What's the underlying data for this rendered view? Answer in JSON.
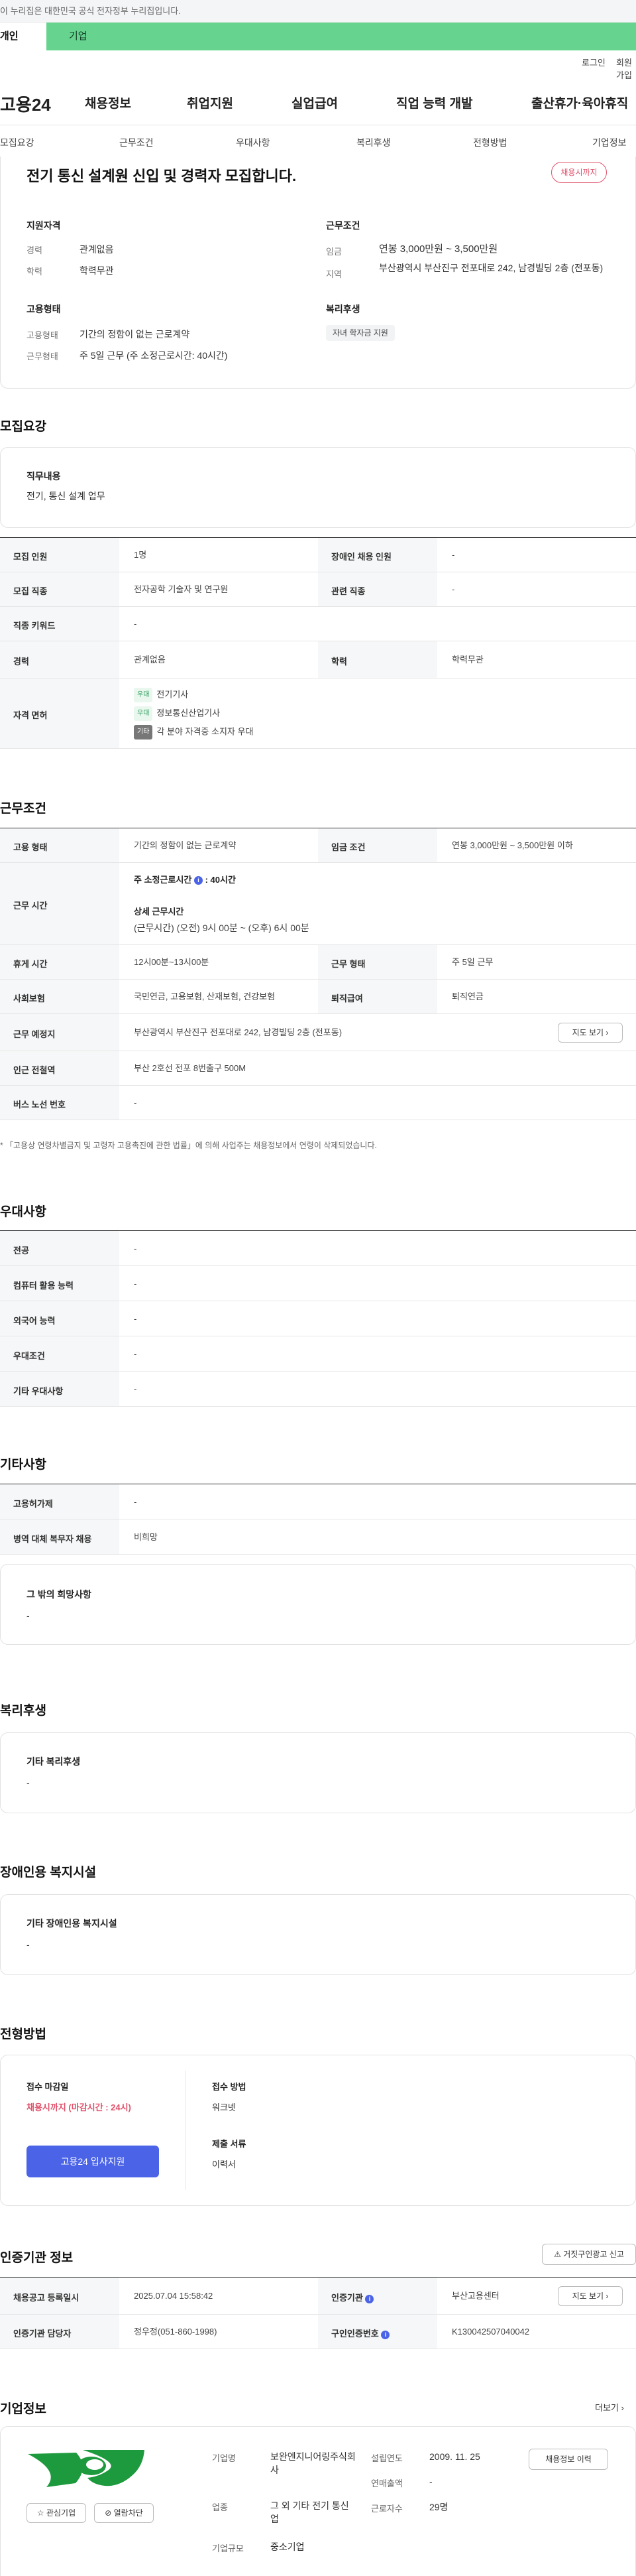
{
  "gov_banner": "이 누리집은 대한민국 공식 전자정부 누리집입니다.",
  "user_tabs": [
    "개인",
    "기업"
  ],
  "auth": [
    "로그인",
    "회원가입"
  ],
  "logo": "고용24",
  "gnb": [
    "채용정보",
    "취업지원",
    "실업급여",
    "직업 능력 개발",
    "출산휴가·육아휴직"
  ],
  "subnav": [
    "모집요강",
    "근무조건",
    "우대사항",
    "복리후생",
    "전형방법",
    "기업정보"
  ],
  "job": {
    "title": "전기 통신 설계원 신입 및 경력자 모집합니다.",
    "status": "채용시까지",
    "qualification": {
      "heading": "지원자격",
      "items": [
        {
          "label": "경력",
          "value": "관계없음"
        },
        {
          "label": "학력",
          "value": "학력무관"
        }
      ]
    },
    "conditions": {
      "heading": "근무조건",
      "items": [
        {
          "label": "임금",
          "value": "연봉 3,000만원 ~ 3,500만원"
        },
        {
          "label": "지역",
          "value": "부산광역시 부산진구 전포대로 242, 남경빌딩 2층 (전포동)"
        }
      ]
    },
    "employment": {
      "heading": "고용형태",
      "items": [
        {
          "label": "고용형태",
          "value": "기간의 정함이 없는 근로계약"
        },
        {
          "label": "근무형태",
          "value": "주 5일 근무 (주 소정근로시간: 40시간)"
        }
      ]
    },
    "welfare": {
      "heading": "복리후생",
      "pill": "자녀 학자금 지원"
    }
  },
  "recruit": {
    "heading": "모집요강",
    "duty_label": "직무내용",
    "duty_value": "전기, 통신 설계 업무",
    "rows": {
      "headcount": {
        "label": "모집 인원",
        "value": "1명"
      },
      "disabled": {
        "label": "장애인 채용 인원",
        "value": "-"
      },
      "occupation": {
        "label": "모집 직종",
        "value": "전자공학 기술자 및 연구원"
      },
      "related": {
        "label": "관련 직종",
        "value": "-"
      },
      "keyword": {
        "label": "직종 키워드",
        "value": "-"
      },
      "career": {
        "label": "경력",
        "value": "관계없음"
      },
      "education": {
        "label": "학력",
        "value": "학력무관"
      },
      "license": {
        "label": "자격 면허",
        "items": [
          {
            "tag": "우대",
            "text": "전기기사"
          },
          {
            "tag": "우대",
            "text": "정보통신산업기사"
          },
          {
            "tag": "기타",
            "text": "각 분야 자격증 소지자 우대"
          }
        ]
      }
    }
  },
  "work": {
    "heading": "근무조건",
    "emp_type": {
      "label": "고용 형태",
      "value": "기간의 정함이 없는 근로계약"
    },
    "wage": {
      "label": "임금 조건",
      "value": "연봉 3,000만원 ~ 3,500만원 이하"
    },
    "hours": {
      "label": "근무 시간",
      "weekly_title": "주 소정근로시간",
      "weekly_value": "40시간",
      "detail_title": "상세 근무시간",
      "detail_value": "(근무시간) (오전) 9시 00분 ~ (오후) 6시 00분"
    },
    "break": {
      "label": "휴게 시간",
      "value": "12시00분~13시00분"
    },
    "form": {
      "label": "근무 형태",
      "value": "주 5일 근무"
    },
    "insurance": {
      "label": "사회보험",
      "value": "국민연금, 고용보험, 산재보험, 건강보험"
    },
    "severance": {
      "label": "퇴직급여",
      "value": "퇴직연금"
    },
    "location": {
      "label": "근무 예정지",
      "value": "부산광역시 부산진구 전포대로 242, 남경빌딩 2층 (전포동)",
      "button": "지도 보기"
    },
    "subway": {
      "label": "인근 전철역",
      "value": "부산 2호선 전포 8번출구 500M"
    },
    "bus": {
      "label": "버스 노선 번호",
      "value": "-"
    },
    "note": "* 「고용상 연령차별금지 및 고령자 고용촉진에 관한 법률」에 의해 사업주는 채용정보에서 연령이 삭제되었습니다."
  },
  "preference": {
    "heading": "우대사항",
    "rows": [
      {
        "label": "전공",
        "value": "-"
      },
      {
        "label": "컴퓨터 활용 능력",
        "value": "-"
      },
      {
        "label": "외국어 능력",
        "value": "-"
      },
      {
        "label": "우대조건",
        "value": "-"
      },
      {
        "label": "기타 우대사항",
        "value": "-"
      }
    ]
  },
  "etc": {
    "heading": "기타사항",
    "rows": [
      {
        "label": "고용허가제",
        "value": "-"
      },
      {
        "label": "병역 대체 복무자 채용",
        "value": "비희망"
      }
    ],
    "hope_label": "그 밖의 희망사항",
    "hope_value": "-"
  },
  "benefits": {
    "heading": "복리후생",
    "label": "기타 복리후생",
    "value": "-"
  },
  "facility": {
    "heading": "장애인용 복지시설",
    "label": "기타 장애인용 복지시설",
    "value": "-"
  },
  "process": {
    "heading": "전형방법",
    "deadline_label": "접수 마감일",
    "deadline_value": "채용시까지 (마감시간 : 24시)",
    "apply_button": "고용24 입사지원",
    "method_label": "접수 방법",
    "method_value": "워크넷",
    "docs_label": "제출 서류",
    "docs_value": "이력서"
  },
  "cert": {
    "heading": "인증기관 정보",
    "report_button": "거짓구인광고 신고",
    "reg_date": {
      "label": "채용공고 등록일시",
      "value": "2025.07.04 15:58:42"
    },
    "agency": {
      "label": "인증기관",
      "value": "부산고용센터",
      "button": "지도 보기"
    },
    "manager": {
      "label": "인증기관 담당자",
      "value": "정우정(051-860-1998)"
    },
    "number": {
      "label": "구인인증번호",
      "value": "K130042507040042"
    }
  },
  "company": {
    "heading": "기업정보",
    "more": "더보기",
    "fav_button": "관심기업",
    "block_button": "열람차단",
    "name_label": "기업명",
    "name_value": "보완엔지니어링주식회사",
    "industry_label": "업종",
    "industry_value": "그 외 기타 전기 통신업",
    "size_label": "기업규모",
    "size_value": "중소기업",
    "founded_label": "설립연도",
    "founded_value": "2009. 11. 25",
    "revenue_label": "연매출액",
    "revenue_value": "-",
    "employees_label": "근로자수",
    "employees_value": "29명",
    "history_button": "채용정보 이력",
    "brand_color": "#1e9a3e"
  },
  "colors": {
    "header_green": "#66d48f",
    "apply_blue": "#4a63e7",
    "status_red": "#e0516a"
  }
}
